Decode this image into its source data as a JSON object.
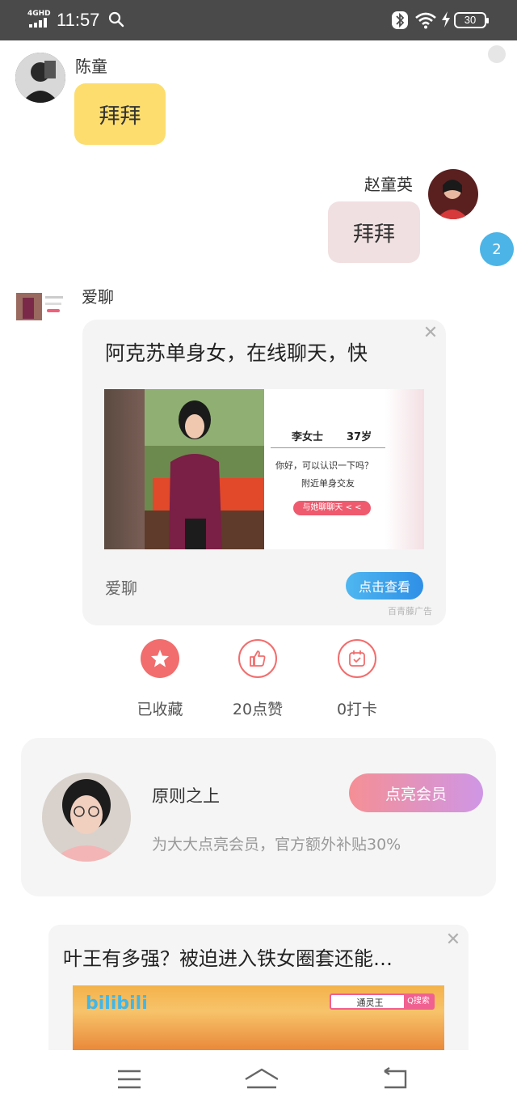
{
  "status_bar": {
    "network": "4GHD",
    "time": "11:57",
    "battery": "30",
    "icons": [
      "search-icon",
      "bluetooth-icon",
      "wifi-icon",
      "charging-icon",
      "battery-icon"
    ]
  },
  "chat": {
    "messages": [
      {
        "sender": "陈童",
        "text": "拜拜",
        "side": "left",
        "bubble_color": "#fcdd6e"
      },
      {
        "sender": "赵童英",
        "text": "拜拜",
        "side": "right",
        "bubble_color": "#f1e0e1"
      }
    ],
    "unread_badge": "2",
    "ad_sender": "爱聊"
  },
  "ad_card": {
    "title": "阿克苏单身女，在线聊天，快",
    "profile_name": "李女士",
    "profile_age": "37岁",
    "profile_line1": "你好，可以认识一下吗？",
    "profile_line2": "附近单身交友",
    "profile_button": "与她聊聊天 < <",
    "brand": "爱聊",
    "cta": "点击查看",
    "source": "百青藤广告",
    "close_icon": "close-icon"
  },
  "actions": [
    {
      "label": "已收藏",
      "icon": "star-icon",
      "color": "#f26d6d"
    },
    {
      "label": "20点赞",
      "icon": "thumbs-up-icon",
      "color": "#f26d6d"
    },
    {
      "label": "0打卡",
      "icon": "calendar-check-icon",
      "color": "#f26d6d"
    }
  ],
  "member_card": {
    "name": "原则之上",
    "button": "点亮会员",
    "description": "为大大点亮会员，官方额外补贴30%"
  },
  "ad2": {
    "title": "叶王有多强？被迫进入铁女圈套还能…",
    "logo": "bilibili",
    "search_text": "通灵王",
    "search_button": "Q搜索"
  },
  "navbar": {
    "icons": [
      "menu-icon",
      "home-icon",
      "back-icon"
    ]
  },
  "colors": {
    "status_bar": "#4a4a4a",
    "accent_blue": "#4cb4e6",
    "yellow_bubble": "#fcdd6e",
    "pink_bubble": "#f1e0e1",
    "action_red": "#f26d6d"
  }
}
